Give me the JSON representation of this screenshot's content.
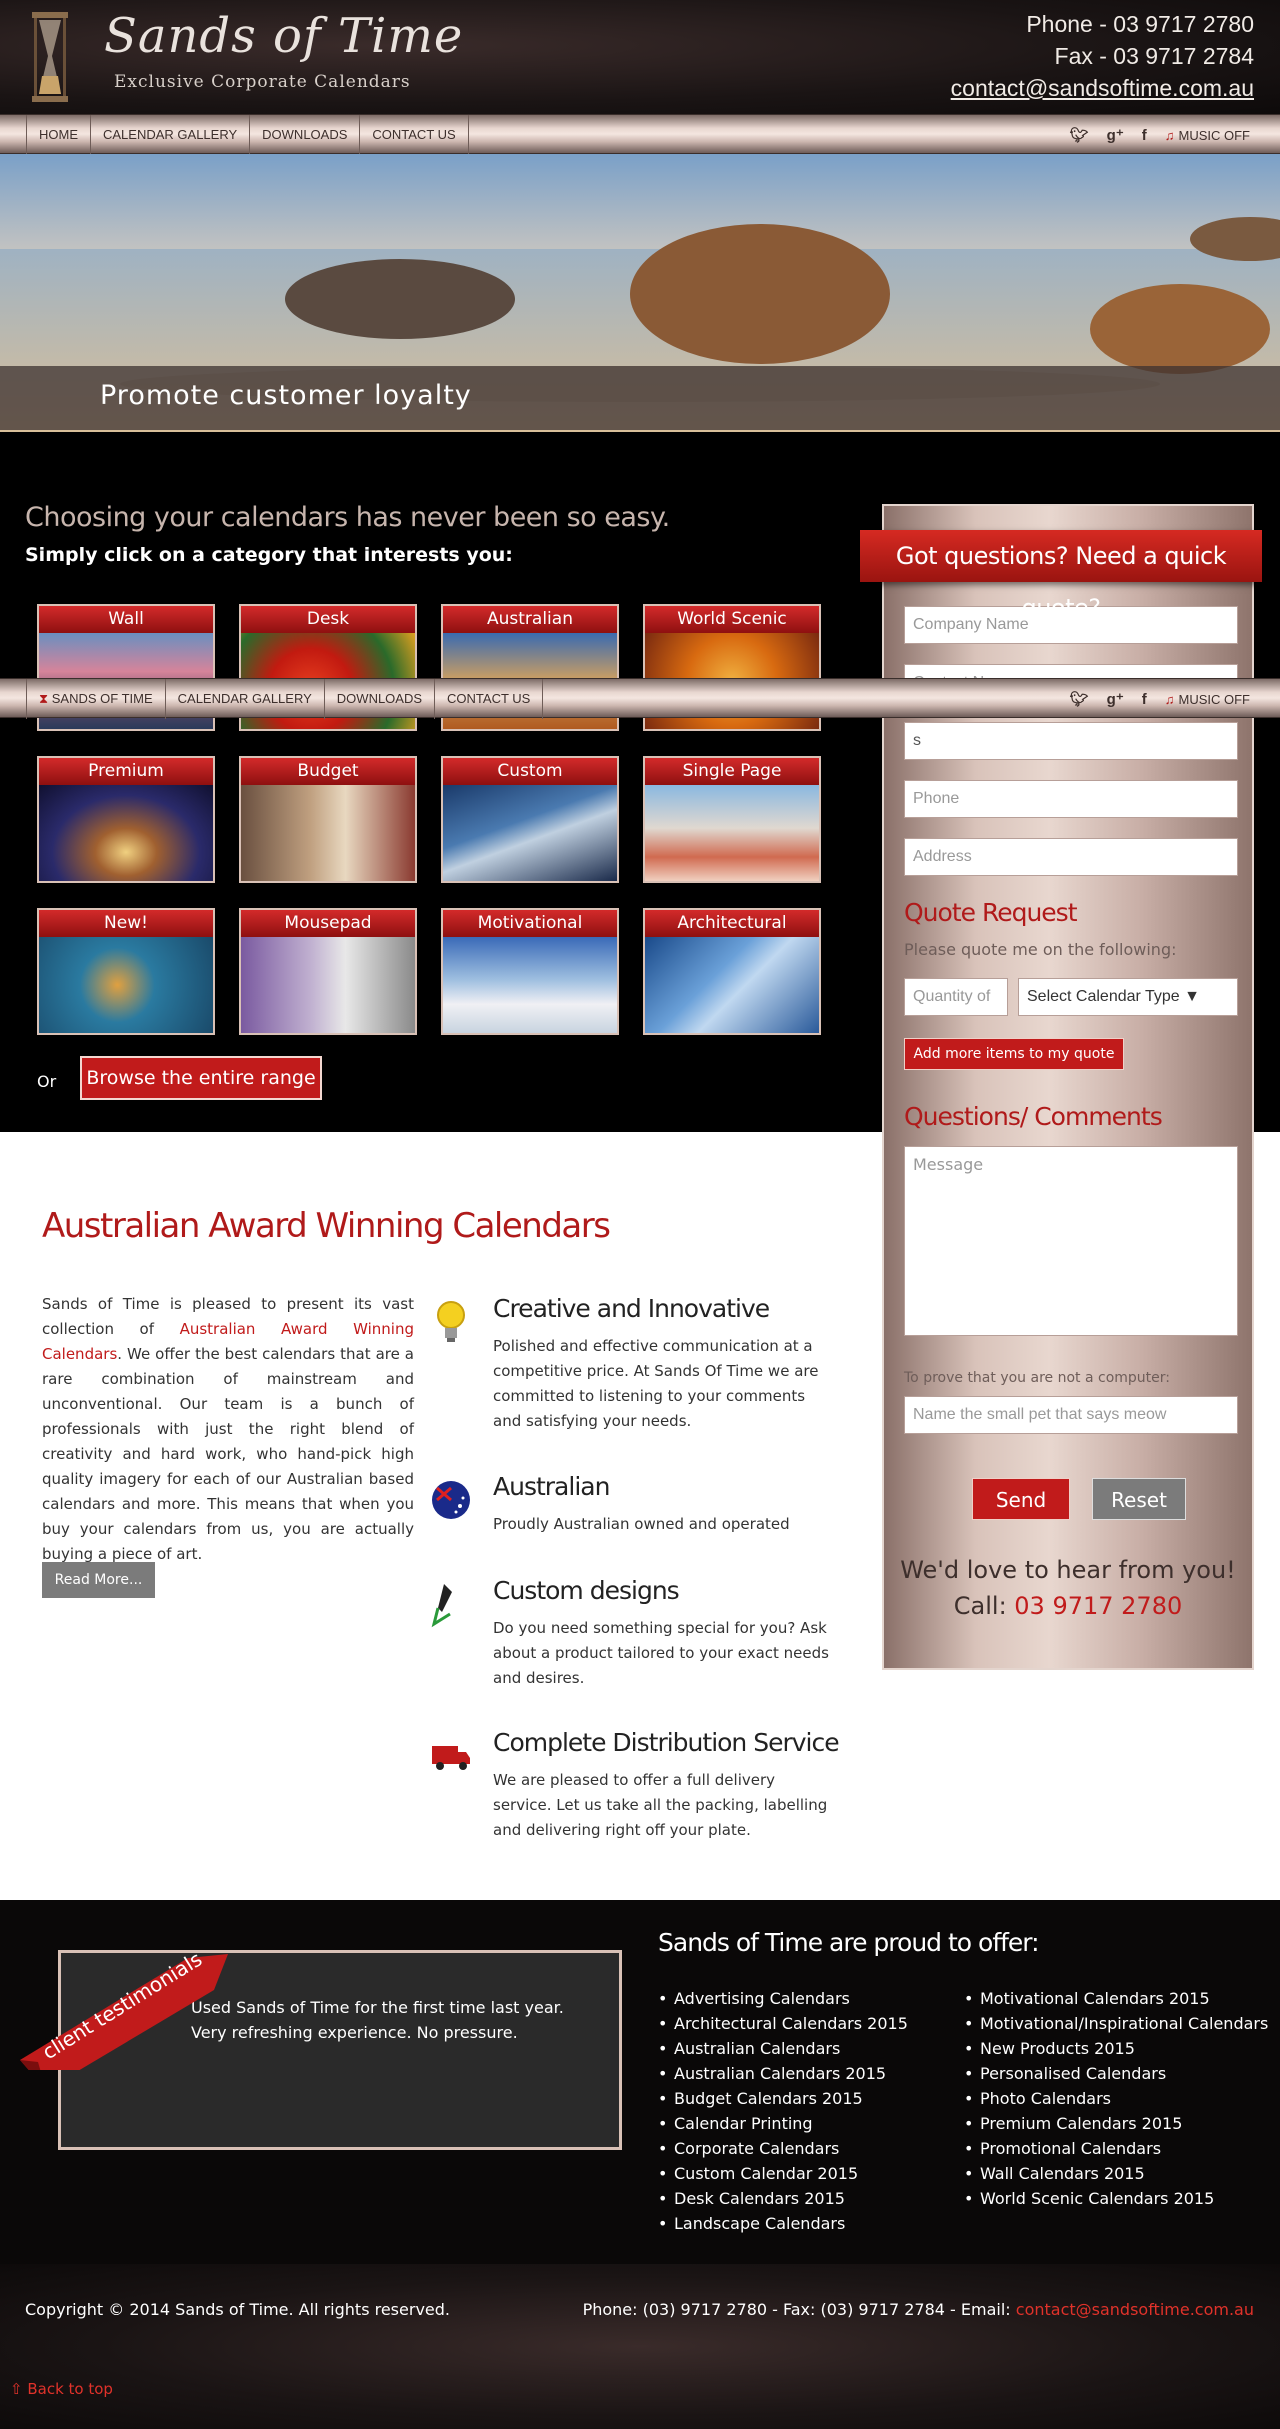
{
  "header": {
    "title": "Sands of Time",
    "subtitle": "Exclusive Corporate Calendars",
    "phone": "Phone - 03 9717 2780",
    "fax": "Fax - 03 9717 2784",
    "email": "contact@sandsoftime.com.au"
  },
  "nav": {
    "items": [
      "HOME",
      "CALENDAR GALLERY",
      "DOWNLOADS",
      "CONTACT US"
    ],
    "sticky_items": [
      "SANDS OF TIME",
      "CALENDAR GALLERY",
      "DOWNLOADS",
      "CONTACT US"
    ],
    "music": "MUSIC OFF",
    "icons": [
      "twitter-icon",
      "google-plus-icon",
      "facebook-icon",
      "music-icon"
    ]
  },
  "hero": {
    "caption": "Promote customer loyalty"
  },
  "categories": {
    "heading": "Choosing your calendars has never been so easy.",
    "subheading": "Simply click on a category that interests you:",
    "tiles": [
      "Wall",
      "Desk",
      "Australian",
      "World Scenic",
      "Premium",
      "Budget",
      "Custom",
      "Single Page",
      "New!",
      "Mousepad",
      "Motivational",
      "Architectural"
    ],
    "or": "Or",
    "browse": "Browse the entire range"
  },
  "quote": {
    "ribbon": "Got questions? Need a quick quote?",
    "company_ph": "Company Name",
    "contact_ph": "Contact Name",
    "email_value": "s",
    "phone_ph": "Phone",
    "address_ph": "Address",
    "request_heading": "Quote Request",
    "request_note": "Please quote me on the following:",
    "quantity_ph": "Quantity of",
    "type_select": "Select Calendar Type ▼",
    "add_more": "Add more items to my quote",
    "comments_heading": "Questions/ Comments",
    "message_ph": "Message",
    "captcha_label": "To prove that you are not a computer:",
    "captcha_ph": "Name the small pet that says meow",
    "send": "Send",
    "reset": "Reset",
    "love": "We'd love to hear from you!",
    "call_label": "Call: ",
    "call_number": "03 9717 2780"
  },
  "awards": {
    "title": "Australian Award Winning Calendars",
    "para_start": "Sands of Time is pleased to present its vast collection of ",
    "para_link": "Australian Award Winning Calendars",
    "para_end": ". We offer the best calendars that are a rare combination of mainstream and unconventional. Our team is a bunch of professionals with just the right blend of creativity and hard work, who hand-pick high quality imagery for each of our Australian based calendars and more. This means that when you buy your calendars from us, you are actually buying a piece of art.",
    "read_more": "Read More...",
    "features": [
      {
        "title": "Creative and Innovative",
        "text": "Polished and effective communication at a competitive price. At Sands Of Time we are committed to listening to your comments and satisfying your needs."
      },
      {
        "title": "Australian",
        "text": "Proudly Australian owned and operated"
      },
      {
        "title": "Custom designs",
        "text": "Do you need something special for you? Ask about a product tailored to your exact needs and desires."
      },
      {
        "title": "Complete Distribution Service",
        "text": "We are pleased to offer a full delivery service. Let us take all the packing, labelling and delivering right off your plate."
      }
    ]
  },
  "testimonials": {
    "ribbon": "client testimonials",
    "quote": "Used Sands of Time for the first time last year. Very refreshing experience. No pressure."
  },
  "offer": {
    "title": "Sands of Time are proud to offer:",
    "col1": [
      "Advertising Calendars",
      "Architectural Calendars 2015",
      "Australian Calendars",
      "Australian Calendars 2015",
      "Budget Calendars 2015",
      "Calendar Printing",
      "Corporate Calendars",
      "Custom Calendar 2015",
      "Desk Calendars 2015",
      "Landscape Calendars"
    ],
    "col2": [
      "Motivational Calendars 2015",
      "Motivational/Inspirational Calendars",
      "New Products 2015",
      "Personalised Calendars",
      "Photo Calendars",
      "Premium Calendars 2015",
      "Promotional Calendars",
      "Wall Calendars 2015",
      "World Scenic Calendars 2015"
    ]
  },
  "footer": {
    "copyright": "Copyright © 2014 Sands of Time. All rights reserved.",
    "contact": "Phone: (03) 9717 2780 - Fax: (03) 9717 2784 - Email: ",
    "email": "contact@sandsoftime.com.au",
    "back_to_top": "⇧ Back to top"
  },
  "colors": {
    "accent_red": "#c11b1b",
    "panel_tan": "#d9c3ba",
    "dark_bg": "#000000"
  }
}
